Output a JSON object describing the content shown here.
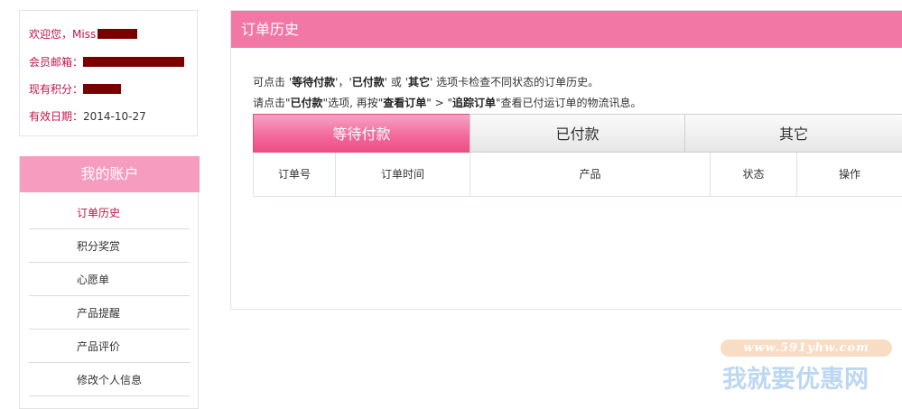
{
  "account": {
    "welcome_label": "欢迎您，Miss",
    "email_label": "会员邮箱：",
    "points_label": "现有积分：",
    "expiry_label": "有效日期：",
    "expiry_value": "2014-10-27"
  },
  "sidebar": {
    "title": "我的账户",
    "items": [
      {
        "label": "订单历史"
      },
      {
        "label": "积分奖赏"
      },
      {
        "label": "心愿单"
      },
      {
        "label": "产品提醒"
      },
      {
        "label": "产品评价"
      },
      {
        "label": "修改个人信息"
      }
    ]
  },
  "main": {
    "title": "订单历史",
    "instruction1": {
      "p1": "可点击 '",
      "b1": "等待付款",
      "p2": "'，'",
      "b2": "已付款",
      "p3": "' 或 '",
      "b3": "其它",
      "p4": "' 选项卡检查不同状态的订单历史。"
    },
    "instruction2": {
      "p1": "请点击\"",
      "b1": "已付款",
      "p2": "\"选项, 再按\"",
      "b2": "查看订单",
      "p3": "\" > \"",
      "b3": "追踪订单",
      "p4": "\"查看已付运订单的物流讯息。"
    },
    "tabs": [
      {
        "label": "等待付款"
      },
      {
        "label": "已付款"
      },
      {
        "label": "其它"
      }
    ],
    "columns": [
      "订单号",
      "订单时间",
      "产品",
      "状态",
      "操作"
    ]
  },
  "watermark": {
    "url": "www.591yhw.com",
    "text": "我就要优惠网"
  },
  "colors": {
    "accent": "#f277a5",
    "active_tab": "#ec4f86",
    "label": "#c0144a",
    "sidebar_header": "#f59cbf"
  }
}
